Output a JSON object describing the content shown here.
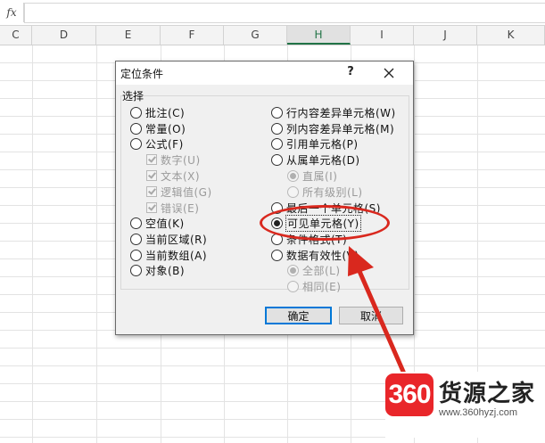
{
  "formula_bar": {
    "fx_label": "fx",
    "value": ""
  },
  "columns": [
    "C",
    "D",
    "E",
    "F",
    "G",
    "H",
    "I",
    "J",
    "K"
  ],
  "selected_column": "H",
  "dialog": {
    "title": "定位条件",
    "help_label": "?",
    "group_label": "选择",
    "left_options": [
      {
        "label": "批注(C)",
        "type": "radio",
        "checked": false,
        "disabled": false
      },
      {
        "label": "常量(O)",
        "type": "radio",
        "checked": false,
        "disabled": false
      },
      {
        "label": "公式(F)",
        "type": "radio",
        "checked": false,
        "disabled": false
      },
      {
        "label": "数字(U)",
        "type": "check",
        "checked": true,
        "disabled": true
      },
      {
        "label": "文本(X)",
        "type": "check",
        "checked": true,
        "disabled": true
      },
      {
        "label": "逻辑值(G)",
        "type": "check",
        "checked": true,
        "disabled": true
      },
      {
        "label": "错误(E)",
        "type": "check",
        "checked": true,
        "disabled": true
      },
      {
        "label": "空值(K)",
        "type": "radio",
        "checked": false,
        "disabled": false
      },
      {
        "label": "当前区域(R)",
        "type": "radio",
        "checked": false,
        "disabled": false
      },
      {
        "label": "当前数组(A)",
        "type": "radio",
        "checked": false,
        "disabled": false
      },
      {
        "label": "对象(B)",
        "type": "radio",
        "checked": false,
        "disabled": false
      }
    ],
    "right_options": [
      {
        "label": "行内容差异单元格(W)",
        "type": "radio",
        "checked": false,
        "disabled": false
      },
      {
        "label": "列内容差异单元格(M)",
        "type": "radio",
        "checked": false,
        "disabled": false
      },
      {
        "label": "引用单元格(P)",
        "type": "radio",
        "checked": false,
        "disabled": false
      },
      {
        "label": "从属单元格(D)",
        "type": "radio",
        "checked": false,
        "disabled": false
      },
      {
        "label": "直属(I)",
        "type": "radio",
        "checked": true,
        "disabled": true
      },
      {
        "label": "所有级别(L)",
        "type": "radio",
        "checked": false,
        "disabled": true
      },
      {
        "label": "最后一个单元格(S)",
        "type": "radio",
        "checked": false,
        "disabled": false
      },
      {
        "label": "可见单元格(Y)",
        "type": "radio",
        "checked": true,
        "disabled": false
      },
      {
        "label": "条件格式(T)",
        "type": "radio",
        "checked": false,
        "disabled": false
      },
      {
        "label": "数据有效性(V)",
        "type": "radio",
        "checked": false,
        "disabled": false
      },
      {
        "label": "全部(L)",
        "type": "radio",
        "checked": true,
        "disabled": true
      },
      {
        "label": "相同(E)",
        "type": "radio",
        "checked": false,
        "disabled": true
      }
    ],
    "ok_label": "确定",
    "cancel_label": "取消"
  },
  "annotation_color": "#d9281e",
  "watermark": {
    "badge": "360",
    "name": "货源之家",
    "url": "www.360hyzj.com"
  }
}
